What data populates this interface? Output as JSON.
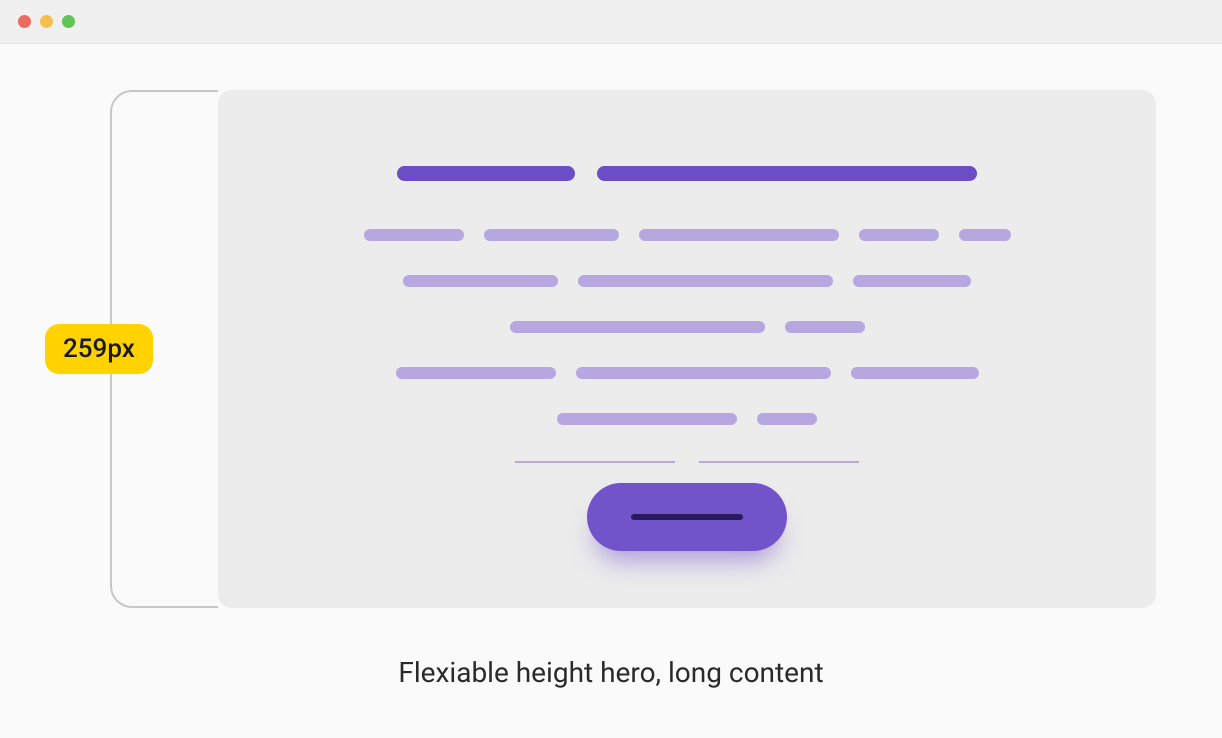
{
  "titlebar": {
    "lights": [
      "close",
      "minimize",
      "zoom"
    ]
  },
  "ruler": {
    "label": "259px"
  },
  "hero": {
    "headline_bars": [
      178,
      380
    ],
    "body_rows": [
      [
        100,
        135,
        200,
        80,
        52
      ],
      [
        155,
        255,
        118
      ],
      [
        255,
        80
      ],
      [
        160,
        255,
        128
      ],
      [
        180,
        60
      ]
    ],
    "thin_bars": [
      160,
      160
    ],
    "cta": {
      "name": "cta-button"
    }
  },
  "caption": "Flexiable height hero, long content",
  "colors": {
    "accent": "#6b4dc5",
    "accent_light": "#b6a7e0",
    "cta": "#7154c9",
    "cta_inner": "#2a1b5c",
    "ruler_label_bg": "#ffd200",
    "card_bg": "#ececec"
  }
}
